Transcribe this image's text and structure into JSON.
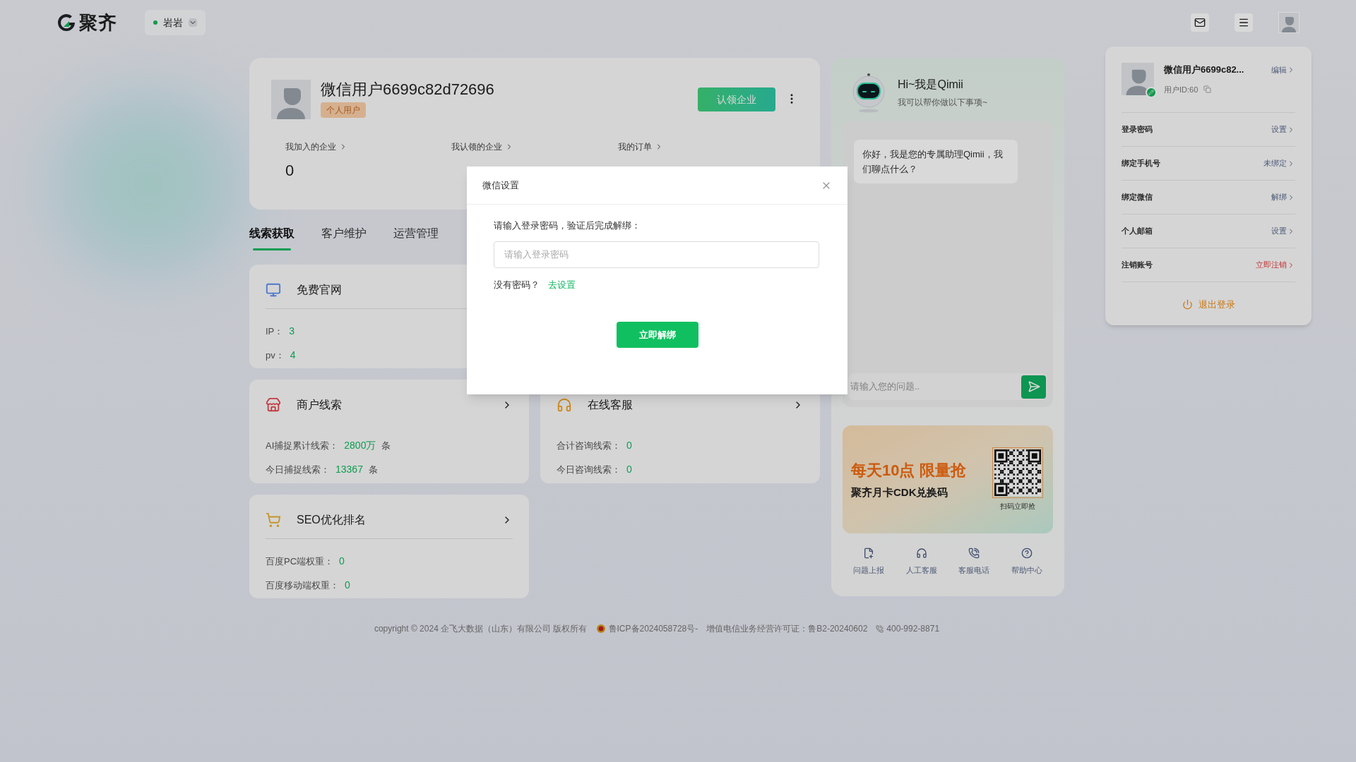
{
  "header": {
    "logo_text": "聚齐",
    "location": {
      "name": "岩岩",
      "online": true
    }
  },
  "profile": {
    "name": "微信用户6699c82d72696",
    "badge": "个人用户",
    "claim_button": "认领企业",
    "stats": [
      {
        "label": "我加入的企业",
        "value": "0"
      },
      {
        "label": "我认领的企业"
      },
      {
        "label": "我的订单"
      }
    ]
  },
  "tabs": [
    {
      "label": "线索获取",
      "selected": true
    },
    {
      "label": "客户维护",
      "selected": false
    },
    {
      "label": "运营管理",
      "selected": false
    }
  ],
  "cards": [
    {
      "title": "免费官网",
      "kind": "monitor",
      "arrow": false,
      "divider": true,
      "rows": [
        {
          "label": "IP：",
          "value": "3"
        },
        {
          "label": "pv：",
          "value": "4"
        }
      ]
    },
    {
      "title": "商户线索",
      "kind": "store",
      "arrow": true,
      "divider": false,
      "rows": [
        {
          "label": "AI捕捉累计线索：",
          "value": "2800万",
          "unit": "条"
        },
        {
          "label": "今日捕捉线索：",
          "value": "13367",
          "unit": "条"
        }
      ]
    },
    {
      "title": "在线客服",
      "kind": "support",
      "arrow": true,
      "divider": false,
      "rows": [
        {
          "label": "合计咨询线索：",
          "value": "0"
        },
        {
          "label": "今日咨询线索：",
          "value": "0"
        }
      ]
    },
    {
      "title": "SEO优化排名",
      "kind": "cart",
      "arrow": true,
      "divider": true,
      "rows": [
        {
          "label": "百度PC端权重：",
          "value": "0"
        },
        {
          "label": "百度移动端权重：",
          "value": "0"
        }
      ]
    }
  ],
  "chat": {
    "title": "Hi~我是Qimii",
    "subtitle": "我可以帮你做以下事项~",
    "messages": [
      "你好，我是您的专属助理Qimii，我们聊点什么？"
    ],
    "input_placeholder": "请输入您的问题.."
  },
  "promo": {
    "headline": "每天10点 限量抢",
    "subline": "聚齐月卡CDK兑换码",
    "qr_caption": "扫码立即抢"
  },
  "shortcuts": [
    {
      "label": "问题上报",
      "kind": "report"
    },
    {
      "label": "人工客服",
      "kind": "headset"
    },
    {
      "label": "客服电话",
      "kind": "phone"
    },
    {
      "label": "帮助中心",
      "kind": "help"
    }
  ],
  "user_menu": {
    "name": "微信用户6699c82...",
    "edit": "编辑",
    "user_id": "用户ID:60",
    "verified": true,
    "items": [
      {
        "label": "登录密码",
        "action": "设置",
        "danger": false
      },
      {
        "label": "绑定手机号",
        "action": "未绑定",
        "danger": false
      },
      {
        "label": "绑定微信",
        "action": "解绑",
        "danger": false
      },
      {
        "label": "个人邮箱",
        "action": "设置",
        "danger": false
      },
      {
        "label": "注销账号",
        "action": "立即注销",
        "danger": true
      }
    ],
    "logout": "退出登录"
  },
  "dialog": {
    "title": "微信设置",
    "prompt": "请输入登录密码，验证后完成解绑：",
    "password_placeholder": "请输入登录密码",
    "no_password": "没有密码？",
    "set_link": "去设置",
    "submit": "立即解绑"
  },
  "footer": {
    "copyright": "copyright © 2024 企飞大数据（山东）有限公司 版权所有",
    "icp": "鲁ICP备2024058728号-",
    "license": "增值电信业务经营许可证：鲁B2-20240602",
    "phone": "400-992-8871"
  }
}
